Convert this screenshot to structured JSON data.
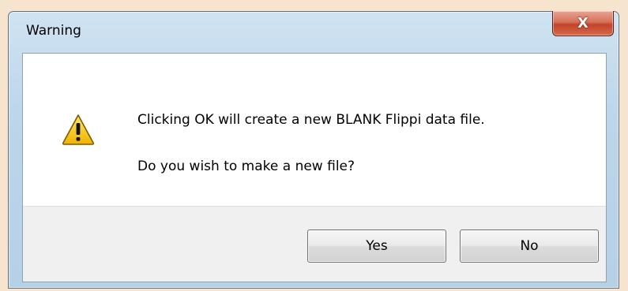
{
  "dialog": {
    "title": "Warning",
    "close_label": "X",
    "icon": "warning-icon",
    "message_line1": "Clicking OK will create a new BLANK Flippi data file.",
    "message_line2": "Do you wish to make a new file?",
    "buttons": {
      "yes_label": "Yes",
      "no_label": "No"
    }
  },
  "colors": {
    "desktop_background": "#f7e4ce",
    "window_frame": "#bcd5e9",
    "close_button": "#c2442a",
    "button_area": "#f0f0f0",
    "warning_yellow": "#f5c400"
  }
}
